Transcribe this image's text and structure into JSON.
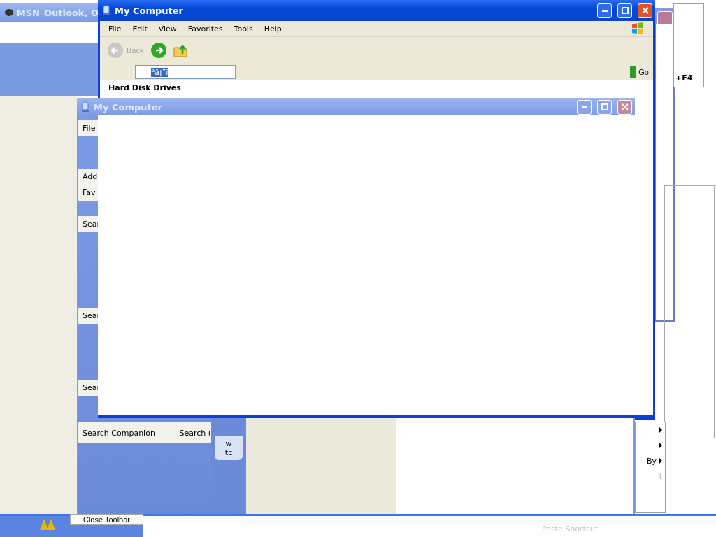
{
  "msn_window": {
    "title": "MSN",
    "title_2": "Outlook, O"
  },
  "main_window": {
    "title": "My Computer",
    "menu": [
      "File",
      "Edit",
      "View",
      "Favorites",
      "Tools",
      "Help"
    ],
    "back_label": "Back",
    "address_value": "ªâ¦¨î",
    "go_label": "Go",
    "section_heading": "Hard Disk Drives"
  },
  "shortcut_menu": {
    "shortcut": "+F4"
  },
  "front_window": {
    "title": "My Computer",
    "side_labels": [
      "File",
      "Add",
      "Fav",
      "Sear",
      "Sear",
      "Sear"
    ],
    "search_bar": [
      "Search Companion",
      "Search ("
    ],
    "balloon": [
      "w",
      "tc"
    ]
  },
  "context_menu": {
    "items": [
      {
        "submenu": true,
        "disabled": false
      },
      {
        "submenu": true,
        "disabled": false
      },
      {
        "label": "By",
        "submenu": true,
        "disabled": false
      },
      {
        "label": "t",
        "submenu": false,
        "disabled": true
      }
    ]
  },
  "taskbar": {
    "menu_item": "Close Toolbar",
    "faded_item": "Paste Shortcut"
  }
}
